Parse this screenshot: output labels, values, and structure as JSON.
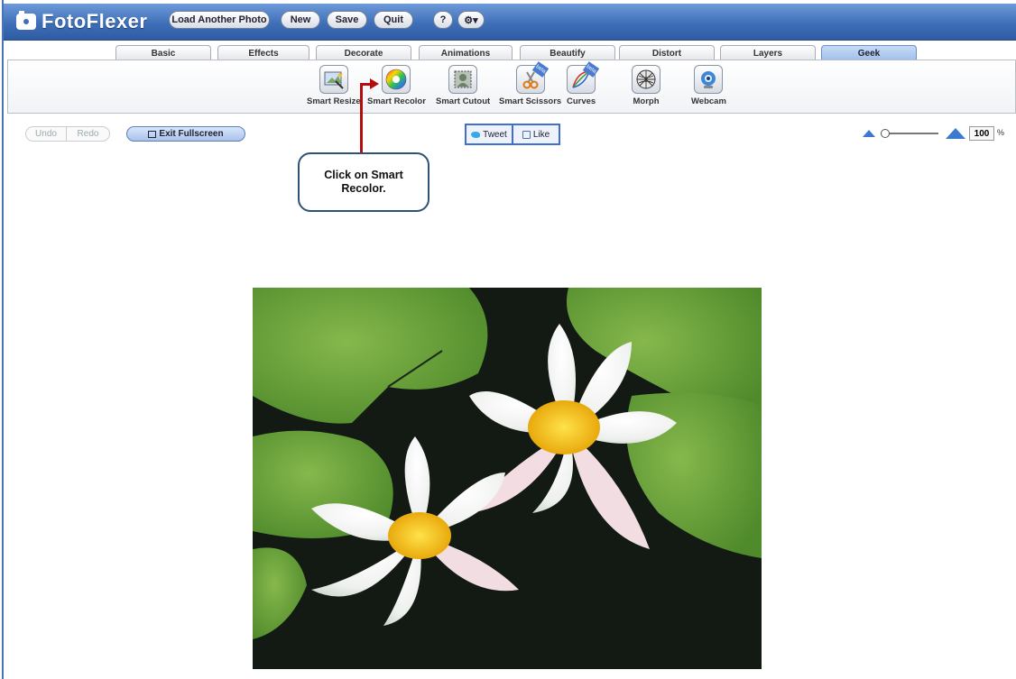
{
  "app": {
    "logo_text": "FotoFlexer"
  },
  "topbar": {
    "buttons": [
      "Load Another Photo",
      "New",
      "Save",
      "Quit"
    ],
    "help_label": "?",
    "settings_label": "⚙▾"
  },
  "tabs": [
    "Basic",
    "Effects",
    "Decorate",
    "Animations",
    "Beautify",
    "Distort",
    "Layers",
    "Geek"
  ],
  "active_tab": "Geek",
  "tools": [
    {
      "label": "Smart Resize",
      "icon": "smart-resize-icon"
    },
    {
      "label": "Smart Recolor",
      "icon": "color-wheel-icon"
    },
    {
      "label": "Smart Cutout",
      "icon": "smart-cutout-icon"
    },
    {
      "label": "Smart Scissors",
      "icon": "scissors-icon",
      "beta": "beta"
    },
    {
      "label": "Curves",
      "icon": "curves-icon",
      "beta": "beta"
    },
    {
      "label": "Morph",
      "icon": "morph-icon"
    },
    {
      "label": "Webcam",
      "icon": "webcam-icon"
    }
  ],
  "actions": {
    "undo": "Undo",
    "redo": "Redo",
    "exit_fullscreen": "Exit Fullscreen"
  },
  "social": {
    "tweet": "Tweet",
    "like": "Like"
  },
  "zoom": {
    "value": "100",
    "unit": "%",
    "level": 0.0
  },
  "callout": {
    "text": "Click on Smart Recolor."
  },
  "colors": {
    "accent_blue": "#3f6fb8",
    "callout_arrow": "#b40d0d",
    "callout_border": "#2f5275"
  }
}
